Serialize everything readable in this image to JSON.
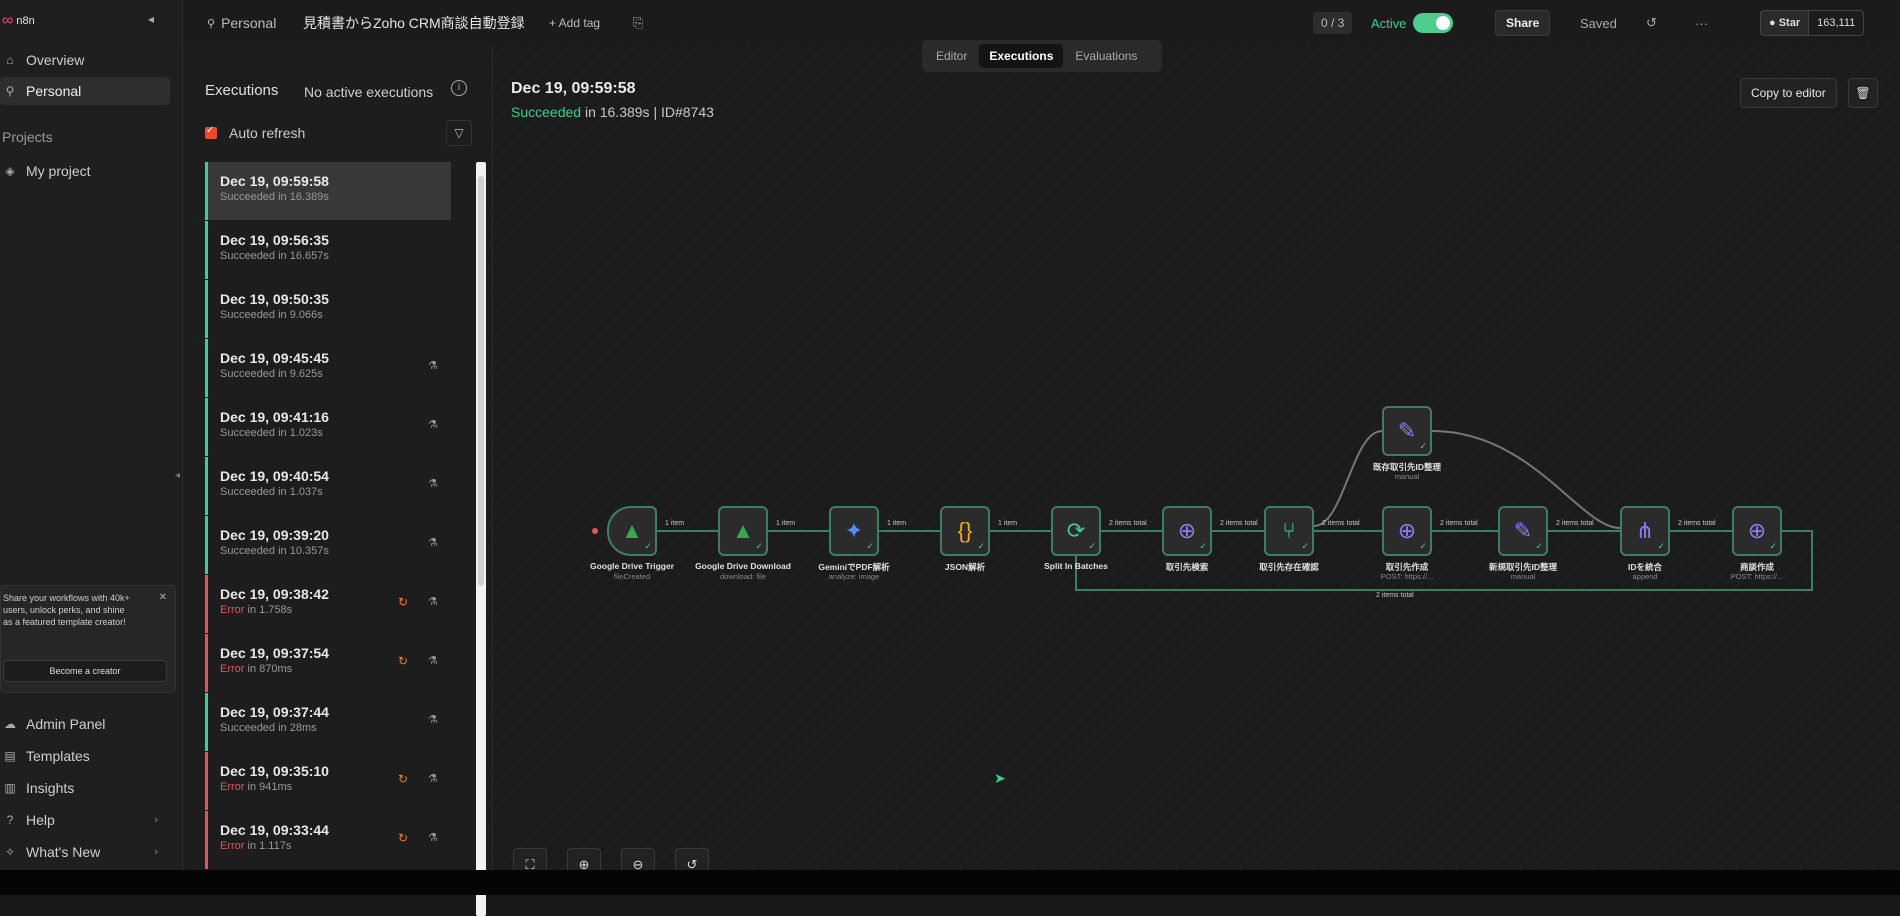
{
  "app": {
    "logo": "n8n"
  },
  "sidebar": {
    "items": [
      {
        "label": "Overview",
        "icon": "home-icon"
      },
      {
        "label": "Personal",
        "icon": "user-icon",
        "active": true
      }
    ],
    "projects_heading": "Projects",
    "projects": [
      {
        "label": "My project",
        "icon": "layers-icon"
      }
    ],
    "promo": {
      "text": "Share your workflows with 40k+ users, unlock perks, and shine as a featured template creator!",
      "button": "Become a creator"
    },
    "bottom": [
      {
        "label": "Admin Panel",
        "icon": "cloud-icon"
      },
      {
        "label": "Templates",
        "icon": "template-icon"
      },
      {
        "label": "Insights",
        "icon": "chart-icon"
      },
      {
        "label": "Help",
        "icon": "help-icon",
        "chevron": true
      },
      {
        "label": "What's New",
        "icon": "bell-icon",
        "chevron": true
      }
    ]
  },
  "header": {
    "breadcrumb": "Personal",
    "workflow_title": "見積書からZoho CRM商談自動登録",
    "add_tag": "+ Add tag",
    "counter": "0 / 3",
    "active_label": "Active",
    "share": "Share",
    "saved": "Saved",
    "star": "Star",
    "star_count": "163,111"
  },
  "tabs": [
    {
      "label": "Editor"
    },
    {
      "label": "Executions",
      "active": true
    },
    {
      "label": "Evaluations"
    }
  ],
  "executions": {
    "title": "Executions",
    "no_active": "No active executions",
    "auto_refresh": "Auto refresh",
    "items": [
      {
        "time": "Dec 19, 09:59:58",
        "status": "Succeeded",
        "duration": "in 16.389s",
        "error": false,
        "selected": true
      },
      {
        "time": "Dec 19, 09:56:35",
        "status": "Succeeded",
        "duration": "in 16.657s",
        "error": false
      },
      {
        "time": "Dec 19, 09:50:35",
        "status": "Succeeded",
        "duration": "in 9.066s",
        "error": false
      },
      {
        "time": "Dec 19, 09:45:45",
        "status": "Succeeded",
        "duration": "in 9.625s",
        "error": false
      },
      {
        "time": "Dec 19, 09:41:16",
        "status": "Succeeded",
        "duration": "in 1.023s",
        "error": false
      },
      {
        "time": "Dec 19, 09:40:54",
        "status": "Succeeded",
        "duration": "in 1.037s",
        "error": false
      },
      {
        "time": "Dec 19, 09:39:20",
        "status": "Succeeded",
        "duration": "in 10.357s",
        "error": false
      },
      {
        "time": "Dec 19, 09:38:42",
        "status": "Error",
        "duration": "in 1.758s",
        "error": true
      },
      {
        "time": "Dec 19, 09:37:54",
        "status": "Error",
        "duration": "in 870ms",
        "error": true
      },
      {
        "time": "Dec 19, 09:37:44",
        "status": "Succeeded",
        "duration": "in 28ms",
        "error": false
      },
      {
        "time": "Dec 19, 09:35:10",
        "status": "Error",
        "duration": "in 941ms",
        "error": true
      },
      {
        "time": "Dec 19, 09:33:44",
        "status": "Error",
        "duration": "in 1.117s",
        "error": true
      }
    ]
  },
  "detail": {
    "date": "Dec 19, 09:59:58",
    "status": "Succeeded",
    "duration": "in 16.389s",
    "id": "| ID#8743",
    "copy_to_editor": "Copy to editor"
  },
  "workflow": {
    "nodes": [
      {
        "label": "Google Drive Trigger",
        "sub": "fileCreated",
        "icon": "gdrive-icon",
        "color": "#34a853"
      },
      {
        "label": "Google Drive Download",
        "sub": "download: file",
        "icon": "gdrive-icon",
        "color": "#34a853"
      },
      {
        "label": "GeminiでPDF解析",
        "sub": "analyze: image",
        "icon": "gemini-icon",
        "color": "#4f8ff7"
      },
      {
        "label": "JSON解析",
        "sub": "",
        "icon": "code-icon",
        "color": "#f5a623"
      },
      {
        "label": "Split In Batches",
        "sub": "",
        "icon": "loop-icon",
        "color": "#3ecf8e"
      },
      {
        "label": "取引先検索",
        "sub": "",
        "icon": "globe-icon",
        "color": "#8b7cf6"
      },
      {
        "label": "取引先存在確認",
        "sub": "",
        "icon": "if-icon",
        "color": "#3ecf8e"
      },
      {
        "label": "取引先作成",
        "sub": "POST: https://...",
        "icon": "globe-icon",
        "color": "#8b7cf6"
      },
      {
        "label": "新規取引先ID整理",
        "sub": "manual",
        "icon": "pencil-icon",
        "color": "#8b7cf6"
      },
      {
        "label": "IDを統合",
        "sub": "append",
        "icon": "merge-icon",
        "color": "#8b7cf6"
      },
      {
        "label": "商談作成",
        "sub": "POST: https://...",
        "icon": "globe-icon",
        "color": "#8b7cf6"
      },
      {
        "label": "既存取引先ID整理",
        "sub": "manual",
        "icon": "pencil-icon",
        "color": "#8b7cf6"
      }
    ],
    "edges": [
      {
        "label": "1 item"
      },
      {
        "label": "1 item"
      },
      {
        "label": "1 item"
      },
      {
        "label": "1 item"
      },
      {
        "label": "2 items total"
      },
      {
        "label": "2 items total"
      },
      {
        "label": "2 items total"
      },
      {
        "label": "2 items total"
      },
      {
        "label": "2 items total"
      },
      {
        "label": "2 items total"
      },
      {
        "label": "2 items total"
      }
    ]
  },
  "colors": {
    "accent": "#ea4b71",
    "success": "#3ecf8e",
    "error": "#e05561",
    "toggle": "#4ecb8d"
  }
}
